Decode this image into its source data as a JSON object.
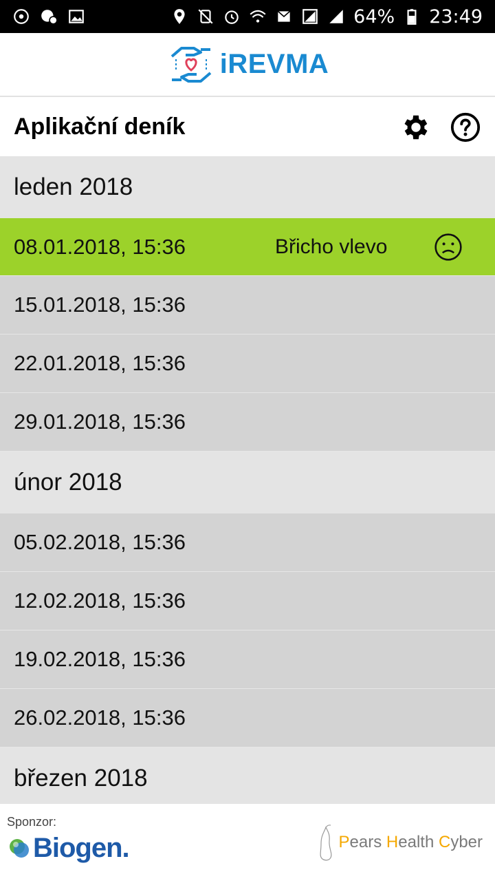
{
  "status_bar": {
    "battery": "64%",
    "time": "23:49"
  },
  "app": {
    "name": "iREVMA"
  },
  "header": {
    "title": "Aplikační deník"
  },
  "sections": [
    {
      "label": "leden 2018",
      "entries": [
        {
          "datetime": "08.01.2018, 15:36",
          "note": "Břicho vlevo",
          "highlighted": true
        },
        {
          "datetime": "15.01.2018, 15:36",
          "note": ""
        },
        {
          "datetime": "22.01.2018, 15:36",
          "note": ""
        },
        {
          "datetime": "29.01.2018, 15:36",
          "note": ""
        }
      ]
    },
    {
      "label": "únor 2018",
      "entries": [
        {
          "datetime": "05.02.2018, 15:36",
          "note": ""
        },
        {
          "datetime": "12.02.2018, 15:36",
          "note": ""
        },
        {
          "datetime": "19.02.2018, 15:36",
          "note": ""
        },
        {
          "datetime": "26.02.2018, 15:36",
          "note": ""
        }
      ]
    },
    {
      "label": "březen 2018",
      "entries": []
    }
  ],
  "footer": {
    "sponsor_label": "Sponzor:",
    "sponsor_name": "Biogen.",
    "partner_parts": {
      "p1": "P",
      "p2": "ears ",
      "p3": "H",
      "p4": "ealth ",
      "p5": "C",
      "p6": "yber"
    }
  },
  "colors": {
    "highlight": "#9cd22a",
    "section_bg": "#e4e4e4",
    "row_bg": "#d3d3d3",
    "brand_blue": "#1a8ad1",
    "partner_yellow": "#f5a800"
  },
  "icons": {
    "settings": "gear-icon",
    "help": "help-circle-icon",
    "mood": "sad-face-icon"
  }
}
